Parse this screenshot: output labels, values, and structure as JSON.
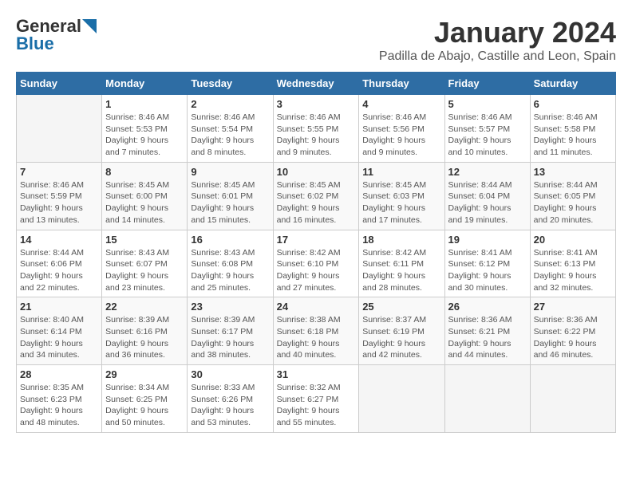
{
  "logo": {
    "general": "General",
    "blue": "Blue"
  },
  "title": "January 2024",
  "subtitle": "Padilla de Abajo, Castille and Leon, Spain",
  "weekdays": [
    "Sunday",
    "Monday",
    "Tuesday",
    "Wednesday",
    "Thursday",
    "Friday",
    "Saturday"
  ],
  "weeks": [
    [
      {
        "day": "",
        "info": ""
      },
      {
        "day": "1",
        "info": "Sunrise: 8:46 AM\nSunset: 5:53 PM\nDaylight: 9 hours\nand 7 minutes."
      },
      {
        "day": "2",
        "info": "Sunrise: 8:46 AM\nSunset: 5:54 PM\nDaylight: 9 hours\nand 8 minutes."
      },
      {
        "day": "3",
        "info": "Sunrise: 8:46 AM\nSunset: 5:55 PM\nDaylight: 9 hours\nand 9 minutes."
      },
      {
        "day": "4",
        "info": "Sunrise: 8:46 AM\nSunset: 5:56 PM\nDaylight: 9 hours\nand 9 minutes."
      },
      {
        "day": "5",
        "info": "Sunrise: 8:46 AM\nSunset: 5:57 PM\nDaylight: 9 hours\nand 10 minutes."
      },
      {
        "day": "6",
        "info": "Sunrise: 8:46 AM\nSunset: 5:58 PM\nDaylight: 9 hours\nand 11 minutes."
      }
    ],
    [
      {
        "day": "7",
        "info": "Sunrise: 8:46 AM\nSunset: 5:59 PM\nDaylight: 9 hours\nand 13 minutes."
      },
      {
        "day": "8",
        "info": "Sunrise: 8:45 AM\nSunset: 6:00 PM\nDaylight: 9 hours\nand 14 minutes."
      },
      {
        "day": "9",
        "info": "Sunrise: 8:45 AM\nSunset: 6:01 PM\nDaylight: 9 hours\nand 15 minutes."
      },
      {
        "day": "10",
        "info": "Sunrise: 8:45 AM\nSunset: 6:02 PM\nDaylight: 9 hours\nand 16 minutes."
      },
      {
        "day": "11",
        "info": "Sunrise: 8:45 AM\nSunset: 6:03 PM\nDaylight: 9 hours\nand 17 minutes."
      },
      {
        "day": "12",
        "info": "Sunrise: 8:44 AM\nSunset: 6:04 PM\nDaylight: 9 hours\nand 19 minutes."
      },
      {
        "day": "13",
        "info": "Sunrise: 8:44 AM\nSunset: 6:05 PM\nDaylight: 9 hours\nand 20 minutes."
      }
    ],
    [
      {
        "day": "14",
        "info": "Sunrise: 8:44 AM\nSunset: 6:06 PM\nDaylight: 9 hours\nand 22 minutes."
      },
      {
        "day": "15",
        "info": "Sunrise: 8:43 AM\nSunset: 6:07 PM\nDaylight: 9 hours\nand 23 minutes."
      },
      {
        "day": "16",
        "info": "Sunrise: 8:43 AM\nSunset: 6:08 PM\nDaylight: 9 hours\nand 25 minutes."
      },
      {
        "day": "17",
        "info": "Sunrise: 8:42 AM\nSunset: 6:10 PM\nDaylight: 9 hours\nand 27 minutes."
      },
      {
        "day": "18",
        "info": "Sunrise: 8:42 AM\nSunset: 6:11 PM\nDaylight: 9 hours\nand 28 minutes."
      },
      {
        "day": "19",
        "info": "Sunrise: 8:41 AM\nSunset: 6:12 PM\nDaylight: 9 hours\nand 30 minutes."
      },
      {
        "day": "20",
        "info": "Sunrise: 8:41 AM\nSunset: 6:13 PM\nDaylight: 9 hours\nand 32 minutes."
      }
    ],
    [
      {
        "day": "21",
        "info": "Sunrise: 8:40 AM\nSunset: 6:14 PM\nDaylight: 9 hours\nand 34 minutes."
      },
      {
        "day": "22",
        "info": "Sunrise: 8:39 AM\nSunset: 6:16 PM\nDaylight: 9 hours\nand 36 minutes."
      },
      {
        "day": "23",
        "info": "Sunrise: 8:39 AM\nSunset: 6:17 PM\nDaylight: 9 hours\nand 38 minutes."
      },
      {
        "day": "24",
        "info": "Sunrise: 8:38 AM\nSunset: 6:18 PM\nDaylight: 9 hours\nand 40 minutes."
      },
      {
        "day": "25",
        "info": "Sunrise: 8:37 AM\nSunset: 6:19 PM\nDaylight: 9 hours\nand 42 minutes."
      },
      {
        "day": "26",
        "info": "Sunrise: 8:36 AM\nSunset: 6:21 PM\nDaylight: 9 hours\nand 44 minutes."
      },
      {
        "day": "27",
        "info": "Sunrise: 8:36 AM\nSunset: 6:22 PM\nDaylight: 9 hours\nand 46 minutes."
      }
    ],
    [
      {
        "day": "28",
        "info": "Sunrise: 8:35 AM\nSunset: 6:23 PM\nDaylight: 9 hours\nand 48 minutes."
      },
      {
        "day": "29",
        "info": "Sunrise: 8:34 AM\nSunset: 6:25 PM\nDaylight: 9 hours\nand 50 minutes."
      },
      {
        "day": "30",
        "info": "Sunrise: 8:33 AM\nSunset: 6:26 PM\nDaylight: 9 hours\nand 53 minutes."
      },
      {
        "day": "31",
        "info": "Sunrise: 8:32 AM\nSunset: 6:27 PM\nDaylight: 9 hours\nand 55 minutes."
      },
      {
        "day": "",
        "info": ""
      },
      {
        "day": "",
        "info": ""
      },
      {
        "day": "",
        "info": ""
      }
    ]
  ]
}
